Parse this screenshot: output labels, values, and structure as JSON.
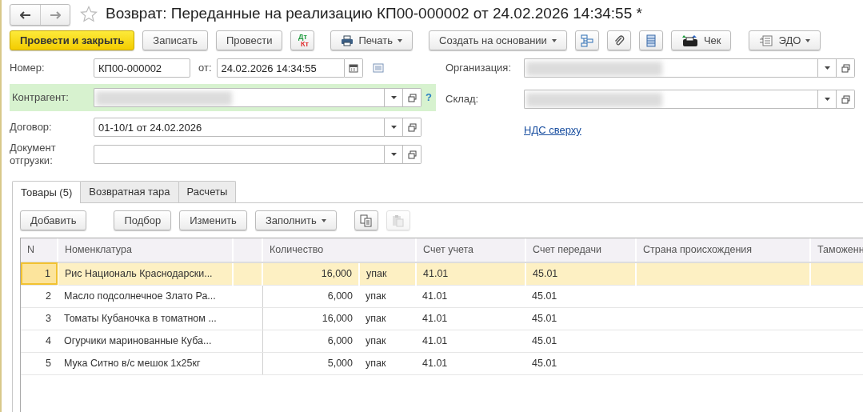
{
  "window": {
    "title": "Возврат: Переданные на реализацию КП00-000002 от 24.02.2026 14:34:55 *",
    "starred": false
  },
  "toolbar": [
    {
      "kind": "primary",
      "label": "Провести и закрыть"
    },
    {
      "kind": "button",
      "label": "Записать"
    },
    {
      "kind": "button",
      "label": "Провести"
    },
    {
      "kind": "accounts",
      "label": "Дт",
      "sublabel": "Кт"
    },
    {
      "kind": "print",
      "label": "Печать"
    },
    {
      "kind": "dropdown",
      "label": "Создать на основании"
    },
    {
      "kind": "structure"
    },
    {
      "kind": "attach"
    },
    {
      "kind": "list"
    },
    {
      "kind": "receipt",
      "label": "Чек"
    },
    {
      "kind": "edo",
      "label": "ЭДО"
    }
  ],
  "fields": {
    "number": {
      "label": "Номер:",
      "value": "КП00-000002"
    },
    "date": {
      "label": "от:",
      "value": "24.02.2026 14:34:55"
    },
    "counterparty": {
      "label": "Контрагент:",
      "redacted": true,
      "highlighted": true,
      "help": "?"
    },
    "contract": {
      "label": "Договор:",
      "value": "01-10/1 от 24.02.2026"
    },
    "shipment_document": {
      "label": "Документ отгрузки:"
    },
    "organization": {
      "label": "Организация:",
      "redacted": true
    },
    "warehouse": {
      "label": "Склад:",
      "redacted": true
    }
  },
  "vat_link": "НДС сверху",
  "tabs": [
    {
      "label": "Товары (5)",
      "selected": true
    },
    {
      "label": "Возвратная тара",
      "selected": false
    },
    {
      "label": "Расчеты",
      "selected": false
    }
  ],
  "table_toolbar": [
    {
      "kind": "button",
      "label": "Добавить",
      "disabled": false
    },
    {
      "kind": "button",
      "label": "Подбор",
      "disabled": false
    },
    {
      "kind": "button",
      "label": "Изменить",
      "disabled": false
    },
    {
      "kind": "dropdown",
      "label": "Заполнить",
      "disabled": false
    },
    {
      "kind": "copy",
      "disabled": false
    },
    {
      "kind": "paste",
      "disabled": true
    }
  ],
  "table": {
    "columns": [
      {
        "label": "N"
      },
      {
        "label": "Номенклатура"
      },
      {
        "label": "Количество"
      },
      {
        "label": "Счет учета"
      },
      {
        "label": "Счет передачи"
      },
      {
        "label": "Страна происхождения"
      },
      {
        "label": "Таможенн"
      }
    ],
    "rows": [
      {
        "n": "1",
        "name": "Рис Националь Краснодарски...",
        "quantity": "16,000",
        "unit": "упак",
        "account": "41.01",
        "transfer_account": "45.01",
        "selected": true
      },
      {
        "n": "2",
        "name": "Масло подсолнечное Злато Ра...",
        "quantity": "6,000",
        "unit": "упак",
        "account": "41.01",
        "transfer_account": "45.01",
        "selected": false
      },
      {
        "n": "3",
        "name": "Томаты Кубаночка в томатном ...",
        "quantity": "16,000",
        "unit": "упак",
        "account": "41.01",
        "transfer_account": "45.01",
        "selected": false
      },
      {
        "n": "4",
        "name": "Огурчики маринованные Куба...",
        "quantity": "6,000",
        "unit": "упак",
        "account": "41.01",
        "transfer_account": "45.01",
        "selected": false
      },
      {
        "n": "5",
        "name": "Мука Ситно в/с мешок 1х25кг",
        "quantity": "5,000",
        "unit": "упак",
        "account": "41.01",
        "transfer_account": "45.01",
        "selected": false
      }
    ]
  }
}
